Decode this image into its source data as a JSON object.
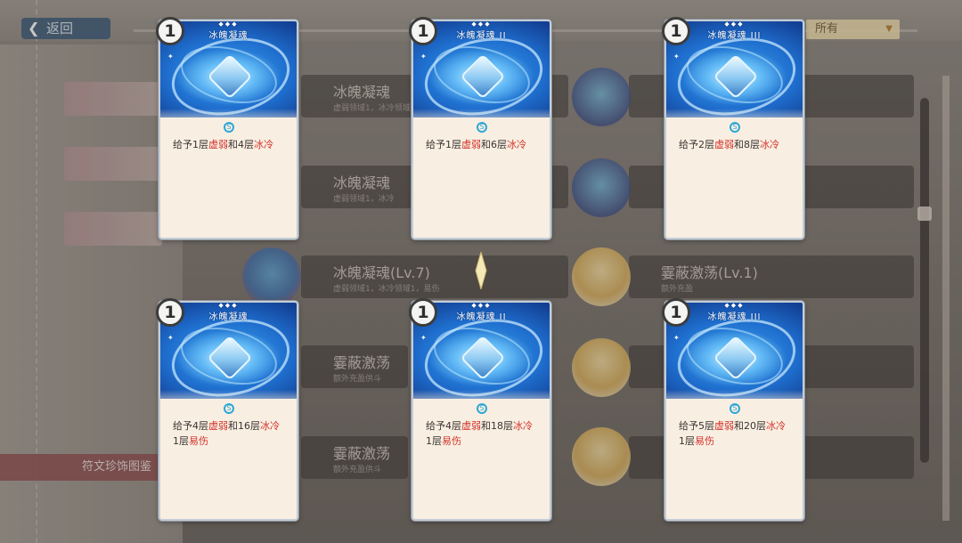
{
  "background": {
    "back_label": "返回",
    "filter_label": "所有",
    "side_title": "符文珍饰图鉴",
    "rows": [
      {
        "title": "冰魄凝魂",
        "subtitle": "虚弱领域1，冰冷领域1"
      },
      {
        "title": "冰魄凝魂",
        "subtitle": "虚弱领域1，冰冷"
      },
      {
        "title": "冰魄凝魂(Lv.7)",
        "subtitle": "虚弱领域1，冰冷领域1，易伤"
      },
      {
        "title": "霎蔽激荡",
        "subtitle": "额外充盈供斗"
      },
      {
        "title": "霎蔽激荡",
        "subtitle": "额外充盈供斗"
      },
      {
        "title": "霎蔽激荡(Lv.1)",
        "subtitle": "额外充盈"
      }
    ]
  },
  "cards": [
    {
      "cost": "1",
      "name": "冰魄凝魂",
      "line1": [
        {
          "t": "给予1层"
        },
        {
          "t": "虚弱",
          "hl": true
        },
        {
          "t": "和4层"
        },
        {
          "t": "冰冷",
          "hl": true
        }
      ],
      "line2": []
    },
    {
      "cost": "1",
      "name": "冰魄凝魂 II",
      "line1": [
        {
          "t": "给予1层"
        },
        {
          "t": "虚弱",
          "hl": true
        },
        {
          "t": "和6层"
        },
        {
          "t": "冰冷",
          "hl": true
        }
      ],
      "line2": []
    },
    {
      "cost": "1",
      "name": "冰魄凝魂 III",
      "line1": [
        {
          "t": "给予2层"
        },
        {
          "t": "虚弱",
          "hl": true
        },
        {
          "t": "和8层"
        },
        {
          "t": "冰冷",
          "hl": true
        }
      ],
      "line2": []
    },
    {
      "cost": "1",
      "name": "冰魄凝魂",
      "line1": [
        {
          "t": "给予4层"
        },
        {
          "t": "虚弱",
          "hl": true
        },
        {
          "t": "和16层"
        },
        {
          "t": "冰冷",
          "hl": true
        }
      ],
      "line2": [
        {
          "t": "1层"
        },
        {
          "t": "易伤",
          "hl": true
        }
      ]
    },
    {
      "cost": "1",
      "name": "冰魄凝魂 II",
      "line1": [
        {
          "t": "给予4层"
        },
        {
          "t": "虚弱",
          "hl": true
        },
        {
          "t": "和18层"
        },
        {
          "t": "冰冷",
          "hl": true
        }
      ],
      "line2": [
        {
          "t": "1层"
        },
        {
          "t": "易伤",
          "hl": true
        }
      ]
    },
    {
      "cost": "1",
      "name": "冰魄凝魂 III",
      "line1": [
        {
          "t": "给予5层"
        },
        {
          "t": "虚弱",
          "hl": true
        },
        {
          "t": "和20层"
        },
        {
          "t": "冰冷",
          "hl": true
        }
      ],
      "line2": [
        {
          "t": "1层"
        },
        {
          "t": "易伤",
          "hl": true
        }
      ]
    }
  ],
  "colors": {
    "highlight": "#d4322b",
    "card_bg": "#f8efe2",
    "art_blue": "#1f6fcf"
  }
}
